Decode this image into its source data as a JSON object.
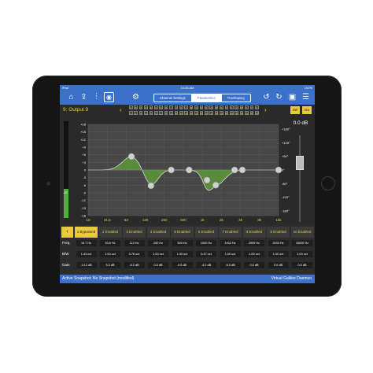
{
  "status": {
    "carrier": "iPad",
    "time": "10:26 AM",
    "battery": "100%"
  },
  "toolbar": {
    "tabs": [
      {
        "label": "Channel Settings"
      },
      {
        "label": "Parametrics",
        "active": true
      },
      {
        "label": "TruShaping"
      }
    ],
    "left_icons": [
      "home-icon",
      "export-icon",
      "mixer-icon",
      "eq-icon",
      "settings-icon"
    ],
    "right_icons": [
      "undo-icon",
      "redo-icon",
      "save-icon",
      "info-icon"
    ]
  },
  "channel": {
    "title": "9: Output 9",
    "prev": "‹",
    "next": "›",
    "grid_labels": [
      "A",
      "B",
      "C",
      "D",
      "E",
      "F",
      "G",
      "H",
      "I",
      "J",
      "K",
      "L",
      "M",
      "N",
      "O",
      "P",
      "Q",
      "R",
      "S",
      "T",
      "U",
      "V",
      "W",
      "X",
      "Y",
      "Z"
    ],
    "grid_numbers": [
      "1",
      "2",
      "3",
      "4",
      "5",
      "6",
      "7",
      "8",
      "9",
      "10",
      "11",
      "12",
      "13",
      "14",
      "15",
      "16",
      "17",
      "18",
      "19",
      "20",
      "21",
      "22",
      "23",
      "24",
      "25",
      "26"
    ],
    "sel_label": "Sel",
    "solo_label": "Iso"
  },
  "eq": {
    "gain_ticks": [
      "+18",
      "+15",
      "+12",
      "+9",
      "+6",
      "+3",
      "0",
      "-3",
      "-6",
      "-9",
      "-12",
      "-15",
      "-18"
    ],
    "phase_ticks": [
      "+180°",
      "+120°",
      "+60°",
      "0°",
      "-60°",
      "-120°",
      "-180°"
    ],
    "freq_ticks": [
      "10",
      "31.5",
      "63",
      "125",
      "250",
      "500",
      "1k",
      "2k",
      "4k",
      "8k",
      "16k"
    ],
    "meter_label": "-20",
    "meter_level": 0.3,
    "db_readout": "0.0 dB",
    "fader_level": 0.72
  },
  "bands": [
    {
      "label": "1 Bypassed",
      "freq": "19.7 Hz",
      "bw": "1.43 oct",
      "gain": "-14.2 dB"
    },
    {
      "label": "2 Enabled",
      "freq": "53.6 Hz",
      "bw": "1.00 oct",
      "gain": "5.3 dB"
    },
    {
      "label": "3 Enabled",
      "freq": "114 Hz",
      "bw": "0.76 oct",
      "gain": "-6.2 dB"
    },
    {
      "label": "4 Enabled",
      "freq": "250 Hz",
      "bw": "1.00 oct",
      "gain": "0.0 dB"
    },
    {
      "label": "5 Enabled",
      "freq": "500 Hz",
      "bw": "1.00 oct",
      "gain": "0.0 dB"
    },
    {
      "label": "6 Enabled",
      "freq": "1000 Hz",
      "bw": "0.47 oct",
      "gain": "-4.0 dB"
    },
    {
      "label": "7 Enabled",
      "freq": "1402 Hz",
      "bw": "1.00 oct",
      "gain": "-6.0 dB"
    },
    {
      "label": "8 Enabled",
      "freq": "2909 Hz",
      "bw": "1.00 oct",
      "gain": "0.0 dB"
    },
    {
      "label": "9 Enabled",
      "freq": "3933 Hz",
      "bw": "1.00 oct",
      "gain": "0.0 dB"
    },
    {
      "label": "10 Enabled",
      "freq": "16000 Hz",
      "bw": "1.00 oct",
      "gain": "0.0 dB"
    }
  ],
  "row_labels": {
    "freq": "Freq.",
    "bw": "B/W",
    "gain": "Gain"
  },
  "back_arrow": "‹",
  "footer": {
    "left": "Active Snapshot: No Snapshot (modified)",
    "right": "Virtual Galileo Daemon"
  },
  "colors": {
    "accent": "#3b71c8",
    "highlight": "#e9c93f",
    "eq_fill": "#5fa23a"
  }
}
